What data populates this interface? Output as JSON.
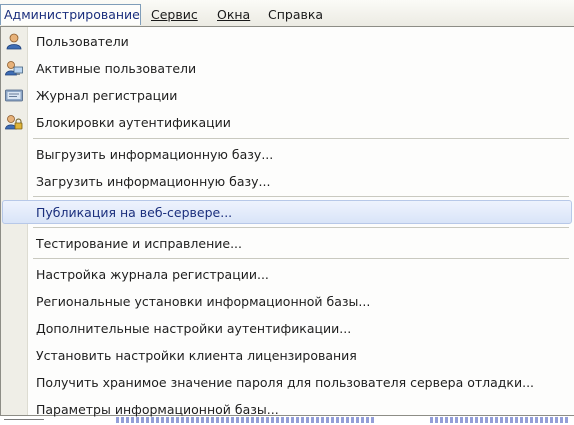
{
  "menubar": {
    "administration": "Администрирование",
    "service": "Сервис",
    "windows": "Окна",
    "help": "Справка"
  },
  "menu": {
    "users": "Пользователи",
    "active_users": "Активные пользователи",
    "event_log": "Журнал регистрации",
    "auth_locks": "Блокировки аутентификации",
    "upload_infobase": "Выгрузить информационную базу...",
    "load_infobase": "Загрузить информационную базу...",
    "web_publish": "Публикация на веб-сервере...",
    "testing_repair": "Тестирование и исправление...",
    "event_log_settings": "Настройка журнала регистрации...",
    "regional_settings": "Региональные установки информационной базы...",
    "extra_auth_settings": "Дополнительные настройки аутентификации...",
    "license_client_settings": "Установить настройки клиента лицензирования",
    "debug_server_password": "Получить хранимое значение пароля для пользователя сервера отладки...",
    "infobase_params": "Параметры информационной базы..."
  },
  "icons": {
    "users": "user-icon",
    "active_users": "user-with-monitor-icon",
    "event_log": "journal-icon",
    "auth_locks": "user-with-lock-icon"
  },
  "colors": {
    "highlight": "#d9e4f8",
    "active_menu_text": "#1b2f7d"
  }
}
